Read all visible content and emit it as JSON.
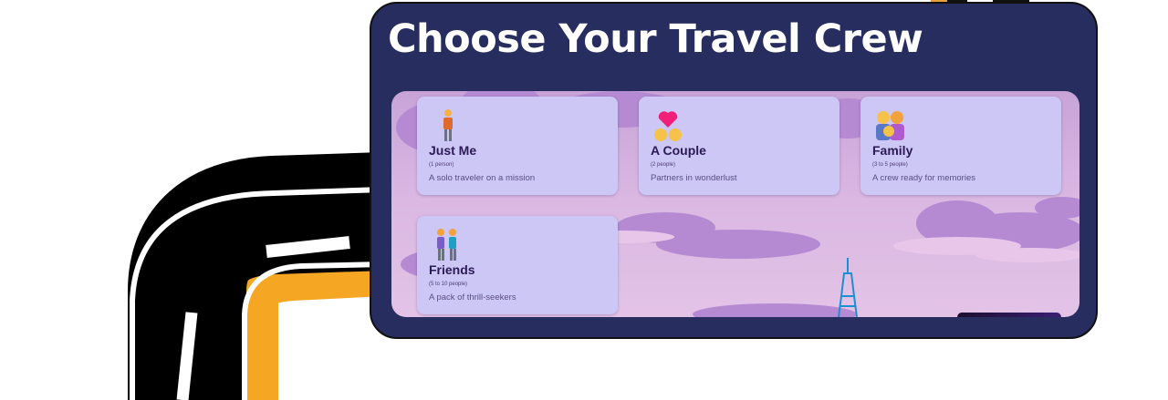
{
  "header": {
    "title": "Choose Your Travel Crew"
  },
  "crew_options": [
    {
      "icon": "person-icon",
      "label": "Just Me",
      "count": "(1 person)",
      "description": "A solo traveler on a mission"
    },
    {
      "icon": "couple-heart-icon",
      "label": "A Couple",
      "count": "(2 people)",
      "description": "Partners in wonderlust"
    },
    {
      "icon": "family-icon",
      "label": "Family",
      "count": "(3 to 5 people)",
      "description": "A crew ready for memories"
    },
    {
      "icon": "friends-icon",
      "label": "Friends",
      "count": "(5 to 10 people)",
      "description": "A pack of thrill-seekers"
    }
  ],
  "colors": {
    "panel": "#272d5e",
    "card": "#cdc7f5",
    "road": "#000000",
    "road_edge": "#f5a623",
    "sky": "#d9b7e2"
  }
}
